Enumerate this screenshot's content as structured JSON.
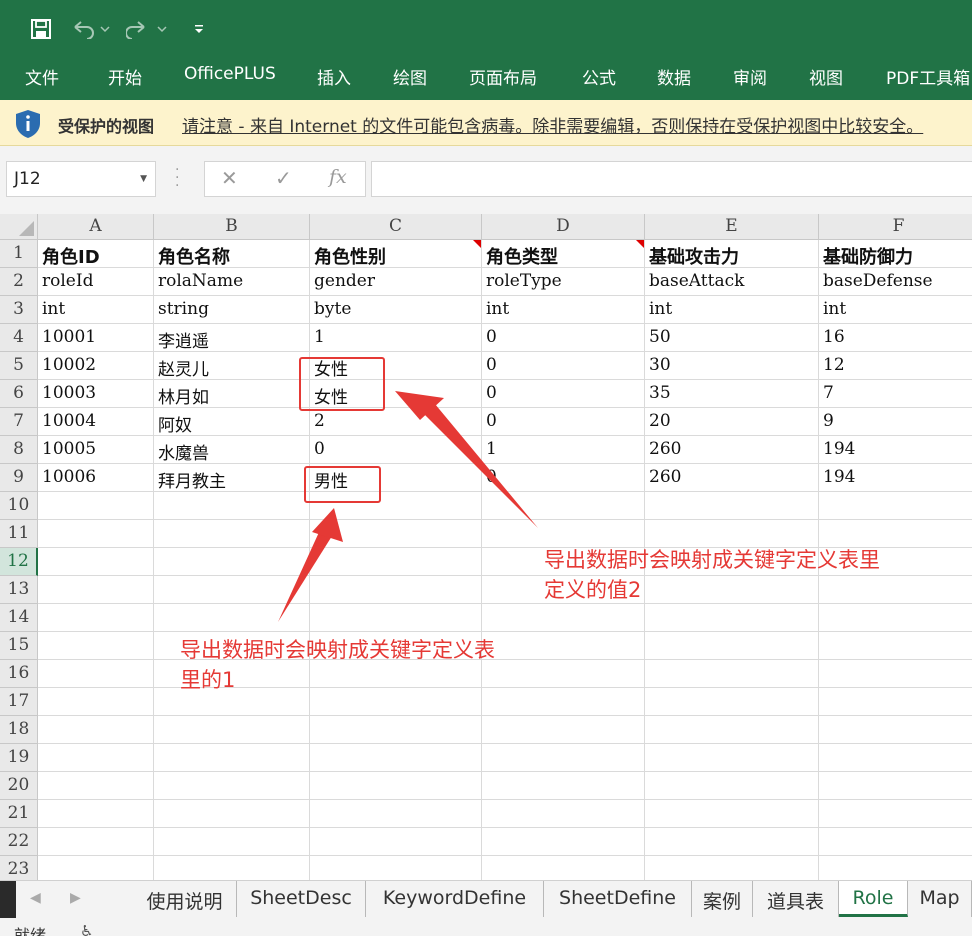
{
  "colors": {
    "brand": "#217346",
    "annotation": "#e53935",
    "warning_bg": "#fdf3cc"
  },
  "qat": {
    "save_icon": "save-icon",
    "undo_icon": "undo-icon",
    "redo_icon": "redo-icon",
    "customize_icon": "customize-qat-icon"
  },
  "ribbon": {
    "tabs": [
      "文件",
      "开始",
      "OfficePLUS",
      "插入",
      "绘图",
      "页面布局",
      "公式",
      "数据",
      "审阅",
      "视图",
      "PDF工具箱"
    ]
  },
  "protected_view": {
    "title": "受保护的视图",
    "message": "请注意 - 来自 Internet 的文件可能包含病毒。除非需要编辑，否则保持在受保护视图中比较安全。"
  },
  "formula_bar": {
    "name_box": "J12",
    "fx_label": "fx",
    "formula": ""
  },
  "grid": {
    "columns": [
      "A",
      "B",
      "C",
      "D",
      "E",
      "F"
    ],
    "rows": [
      "1",
      "2",
      "3",
      "4",
      "5",
      "6",
      "7",
      "8",
      "9",
      "10",
      "11",
      "12",
      "13",
      "14",
      "15",
      "16",
      "17",
      "18",
      "19",
      "20",
      "21",
      "22",
      "23"
    ],
    "selected_row": "12",
    "cells": [
      [
        "角色ID",
        "角色名称",
        "角色性别",
        "角色类型",
        "基础攻击力",
        "基础防御力"
      ],
      [
        "roleId",
        "rolaName",
        "gender",
        "roleType",
        "baseAttack",
        "baseDefense"
      ],
      [
        "int",
        "string",
        "byte",
        "int",
        "int",
        "int"
      ],
      [
        "10001",
        "李逍遥",
        "1",
        "0",
        "50",
        "16"
      ],
      [
        "10002",
        "赵灵儿",
        "女性",
        "0",
        "30",
        "12"
      ],
      [
        "10003",
        "林月如",
        "女性",
        "0",
        "35",
        "7"
      ],
      [
        "10004",
        "阿奴",
        "2",
        "0",
        "20",
        "9"
      ],
      [
        "10005",
        "水魔兽",
        "0",
        "1",
        "260",
        "194"
      ],
      [
        "10006",
        "拜月教主",
        "男性",
        "0",
        "260",
        "194"
      ]
    ]
  },
  "annotations": {
    "note_female": "导出数据时会映射成关键字定义表里\n定义的值2",
    "note_male": "导出数据时会映射成关键字定义表\n里的1"
  },
  "sheet_tabs": [
    "使用说明",
    "SheetDesc",
    "KeywordDefine",
    "SheetDefine",
    "案例",
    "道具表",
    "Role",
    "Map"
  ],
  "active_sheet": "Role",
  "status": {
    "text": "就绪"
  }
}
